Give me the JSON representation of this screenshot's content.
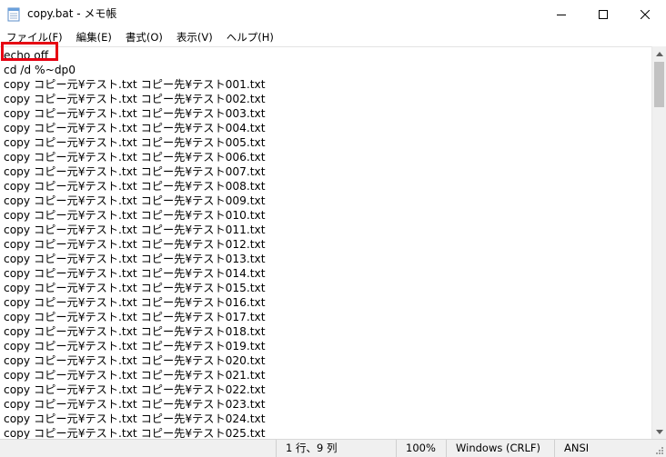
{
  "window": {
    "title": "copy.bat - メモ帳",
    "icon": "notepad-icon",
    "controls": [
      "minimize-icon",
      "maximize-icon",
      "close-icon"
    ]
  },
  "menu": [
    {
      "label": "ファイル(F)"
    },
    {
      "label": "編集(E)"
    },
    {
      "label": "書式(O)"
    },
    {
      "label": "表示(V)"
    },
    {
      "label": "ヘルプ(H)"
    }
  ],
  "editor": {
    "highlight_color": "#e60012",
    "lines": [
      "echo off",
      "cd /d %~dp0",
      "copy コピー元¥テスト.txt コピー先¥テスト001.txt",
      "copy コピー元¥テスト.txt コピー先¥テスト002.txt",
      "copy コピー元¥テスト.txt コピー先¥テスト003.txt",
      "copy コピー元¥テスト.txt コピー先¥テスト004.txt",
      "copy コピー元¥テスト.txt コピー先¥テスト005.txt",
      "copy コピー元¥テスト.txt コピー先¥テスト006.txt",
      "copy コピー元¥テスト.txt コピー先¥テスト007.txt",
      "copy コピー元¥テスト.txt コピー先¥テスト008.txt",
      "copy コピー元¥テスト.txt コピー先¥テスト009.txt",
      "copy コピー元¥テスト.txt コピー先¥テスト010.txt",
      "copy コピー元¥テスト.txt コピー先¥テスト011.txt",
      "copy コピー元¥テスト.txt コピー先¥テスト012.txt",
      "copy コピー元¥テスト.txt コピー先¥テスト013.txt",
      "copy コピー元¥テスト.txt コピー先¥テスト014.txt",
      "copy コピー元¥テスト.txt コピー先¥テスト015.txt",
      "copy コピー元¥テスト.txt コピー先¥テスト016.txt",
      "copy コピー元¥テスト.txt コピー先¥テスト017.txt",
      "copy コピー元¥テスト.txt コピー先¥テスト018.txt",
      "copy コピー元¥テスト.txt コピー先¥テスト019.txt",
      "copy コピー元¥テスト.txt コピー先¥テスト020.txt",
      "copy コピー元¥テスト.txt コピー先¥テスト021.txt",
      "copy コピー元¥テスト.txt コピー先¥テスト022.txt",
      "copy コピー元¥テスト.txt コピー先¥テスト023.txt",
      "copy コピー元¥テスト.txt コピー先¥テスト024.txt",
      "copy コピー元¥テスト.txt コピー先¥テスト025.txt"
    ]
  },
  "status": {
    "position": "1 行、9 列",
    "zoom": "100%",
    "line_ending": "Windows (CRLF)",
    "encoding": "ANSI"
  }
}
